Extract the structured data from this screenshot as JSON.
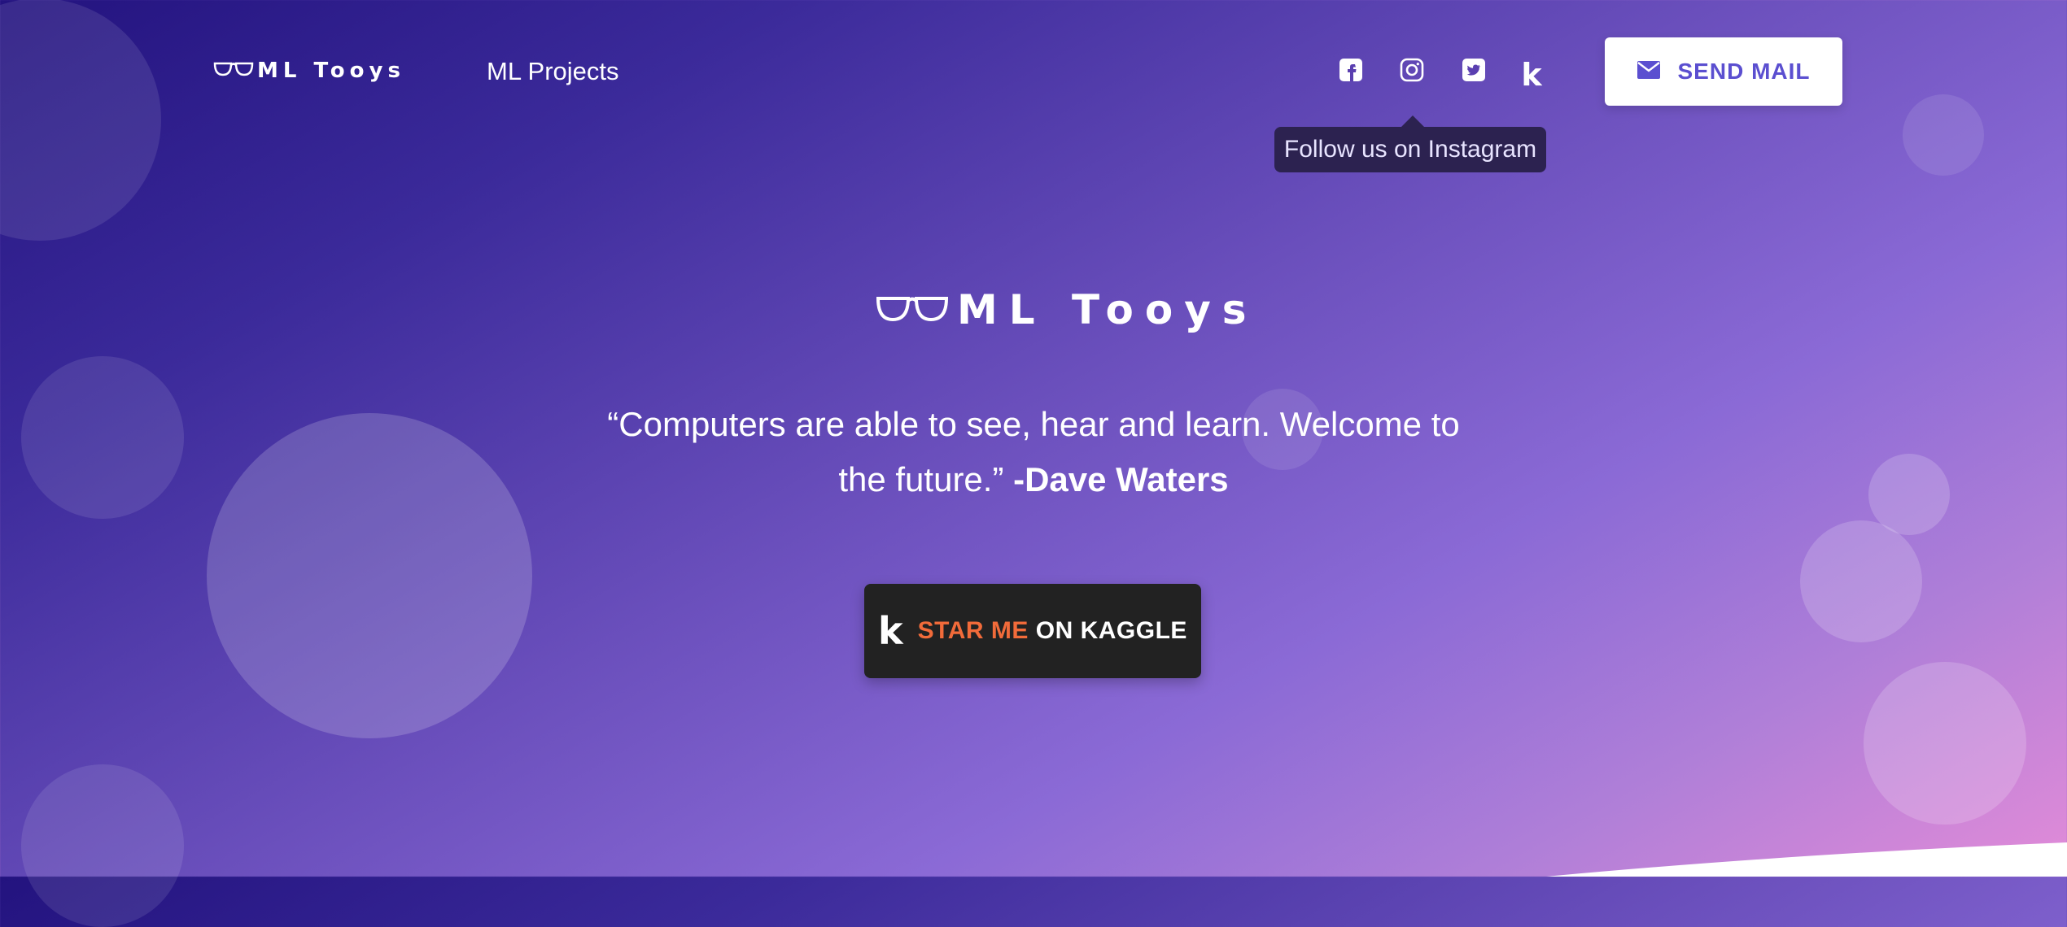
{
  "colors": {
    "accent": "#5b4fd0",
    "kaggle_orange": "#f26b3a",
    "tooltip_bg": "#2c2250",
    "button_dark": "#222222"
  },
  "nav": {
    "brand": "ML Tooys",
    "link_projects": "ML Projects",
    "social_icons": [
      "facebook-icon",
      "instagram-icon",
      "twitter-icon",
      "kaggle-icon"
    ],
    "send_mail_label": "SEND MAIL",
    "send_mail_icon": "envelope-icon"
  },
  "tooltip": {
    "text": "Follow us on Instagram"
  },
  "hero": {
    "title": "ML Tooys",
    "quote": "“Computers are able to see, hear and learn. Welcome to the future.”",
    "author": "-Dave Waters",
    "kaggle_button": {
      "icon_letter": "k",
      "accent": "STAR ME",
      "rest": "ON KAGGLE"
    }
  }
}
